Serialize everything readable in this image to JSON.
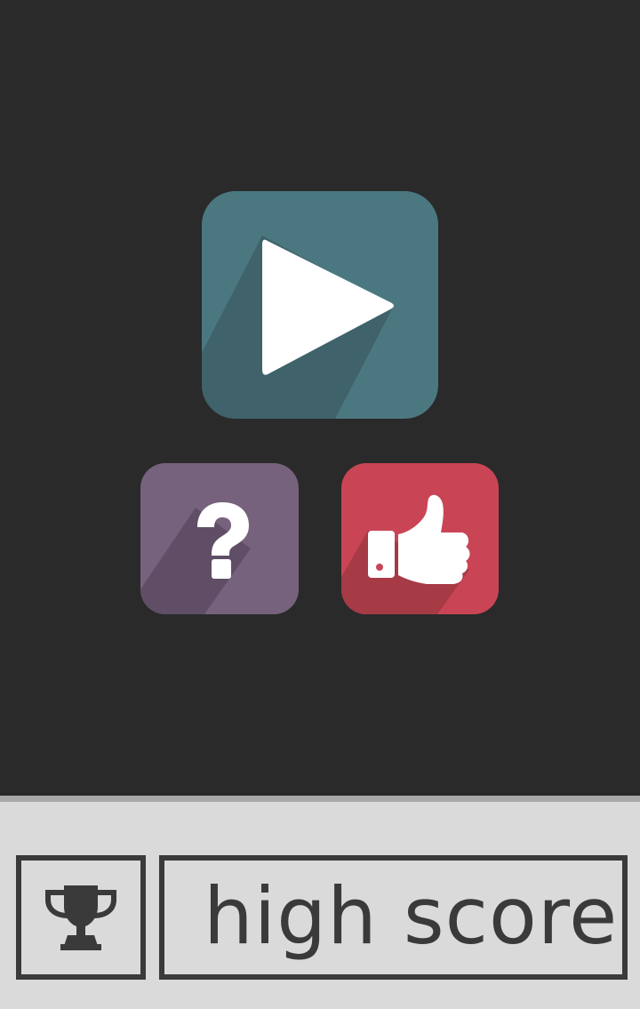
{
  "colors": {
    "background": "#2a2a2a",
    "play_tile": "#4b7880",
    "help_tile": "#77627d",
    "rate_tile": "#c94556",
    "bottom_bar": "#dadada",
    "outline": "#3a3a3a"
  },
  "menu": {
    "play_button": {
      "icon": "play-icon"
    },
    "help_button": {
      "icon": "question-mark-icon"
    },
    "rate_button": {
      "icon": "thumbs-up-icon"
    }
  },
  "bottom_bar": {
    "trophy_button": {
      "icon": "trophy-icon"
    },
    "high_score_label": "high score"
  }
}
